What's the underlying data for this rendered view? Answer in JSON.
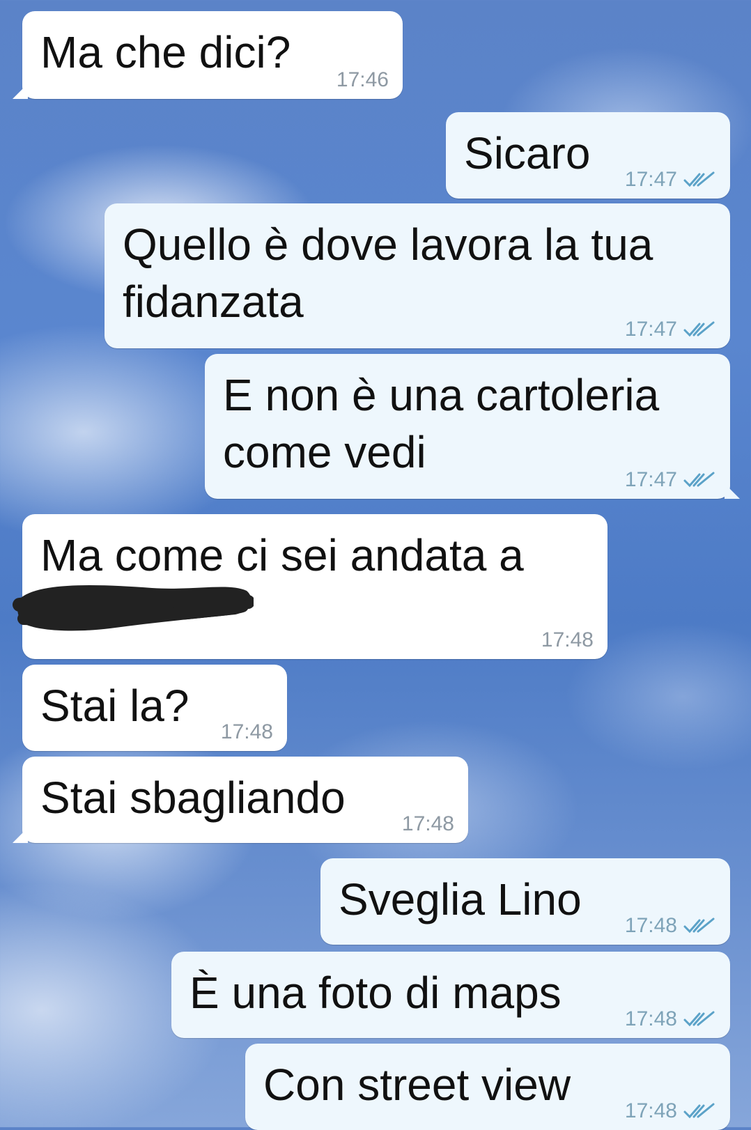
{
  "messages": [
    {
      "dir": "in",
      "text": "Ma che dici?",
      "time": "17:46"
    },
    {
      "dir": "out",
      "text": "Sicaro",
      "time": "17:47",
      "status": "read"
    },
    {
      "dir": "out",
      "text": "Quello è dove lavora la tua\nfidanzata",
      "time": "17:47",
      "status": "read"
    },
    {
      "dir": "out",
      "text": "E non è una cartoleria\ncome vedi",
      "time": "17:47",
      "status": "read"
    },
    {
      "dir": "in",
      "text": "Ma come ci sei andata a",
      "time": "17:48",
      "note": "second line redacted with black marker"
    },
    {
      "dir": "in",
      "text": "Stai la?",
      "time": "17:48"
    },
    {
      "dir": "in",
      "text": "Stai sbagliando",
      "time": "17:48"
    },
    {
      "dir": "out",
      "text": "Sveglia Lino",
      "time": "17:48",
      "status": "read"
    },
    {
      "dir": "out",
      "text": "È una foto di maps",
      "time": "17:48",
      "status": "read"
    },
    {
      "dir": "out",
      "text": "Con street view",
      "time": "17:48",
      "status": "read"
    }
  ],
  "colors": {
    "incoming_bubble": "#ffffff",
    "outgoing_bubble": "#eef7fd",
    "read_ticks": "#5ba2c8",
    "background_sky": "#5a86cf"
  },
  "icons": {
    "read_status": "double-check-icon",
    "redaction": "black-scribble"
  }
}
